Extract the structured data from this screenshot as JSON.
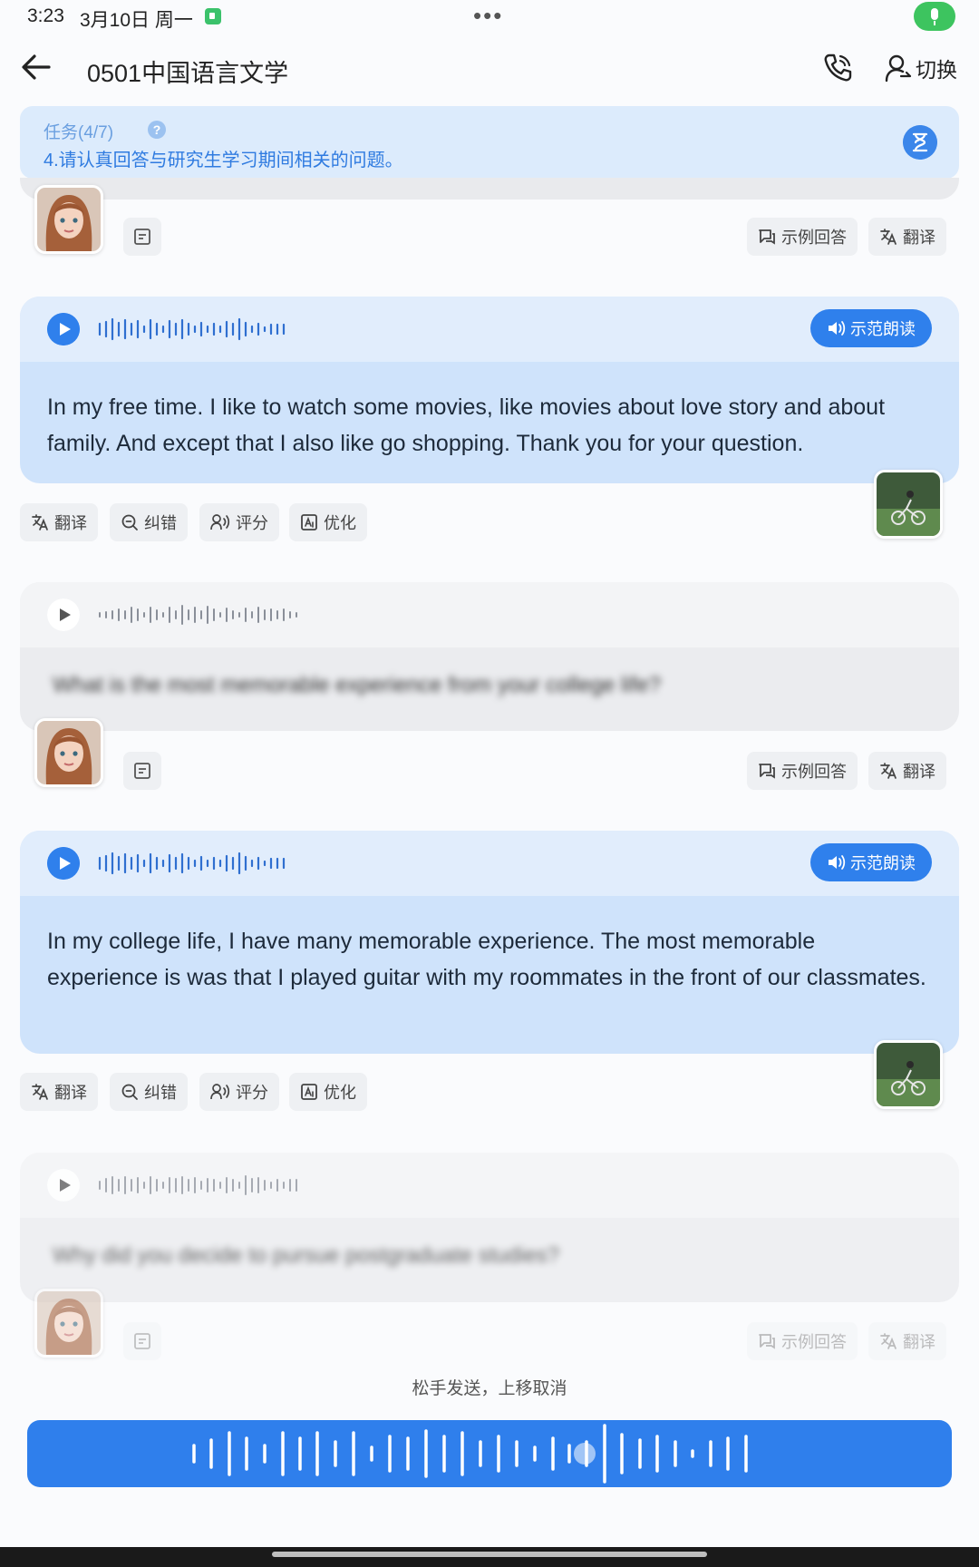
{
  "status": {
    "time": "3:23",
    "date": "3月10日 周一"
  },
  "header": {
    "title": "0501中国语言文学",
    "switch_label": "切换"
  },
  "task": {
    "label": "任务(4/7)",
    "text": "4.请认真回答与研究生学习期间相关的问题。"
  },
  "chips": {
    "example_answer": "示例回答",
    "translate": "翻译",
    "correct": "纠错",
    "score": "评分",
    "optimize": "优化",
    "demo_read": "示范朗读"
  },
  "messages": [
    {
      "role": "user",
      "text": "In my free time. I like to watch some movies, like movies about love story and about family. And except that I also like go shopping. Thank you for your question."
    },
    {
      "role": "ai",
      "text": "What is the most memorable experience from your college life?"
    },
    {
      "role": "user",
      "text": "In my college life, I have many memorable experience. The most memorable experience is was that I played guitar with my roommates in the front of our classmates."
    },
    {
      "role": "ai",
      "text": "Why did you decide to pursue postgraduate studies?"
    }
  ],
  "recording": {
    "hint": "松手发送，上移取消"
  },
  "colors": {
    "accent": "#2f80ec",
    "banner": "#dcebfc",
    "user_bubble": "#cfe3fb"
  }
}
